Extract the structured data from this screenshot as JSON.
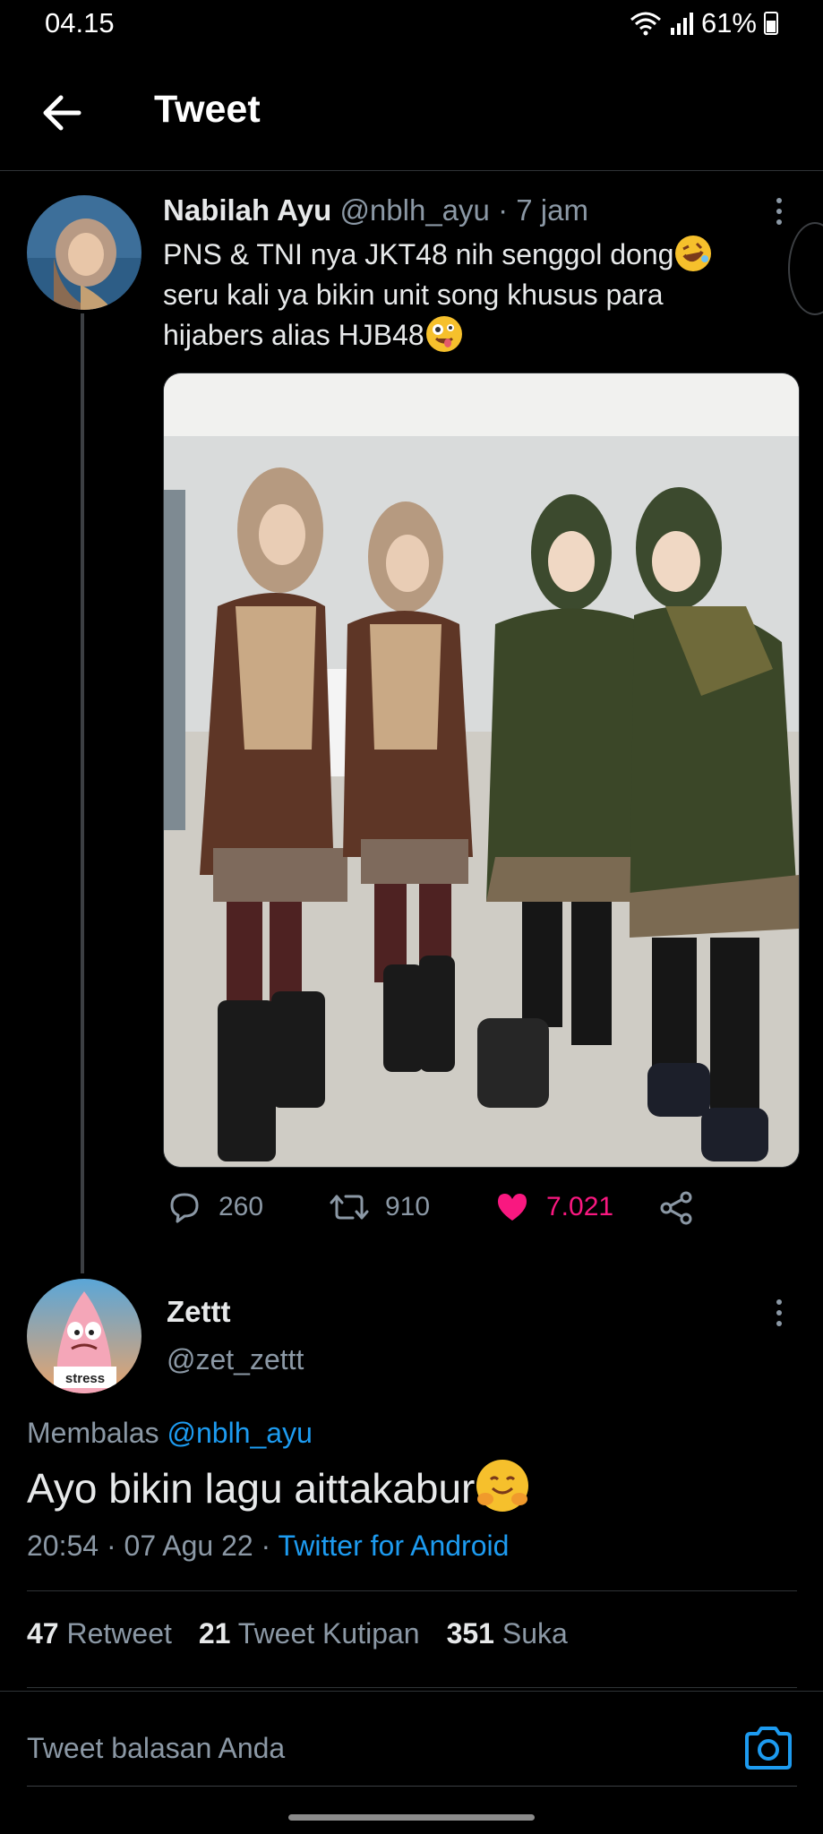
{
  "status_bar": {
    "time": "04.15",
    "battery": "61%"
  },
  "header": {
    "title": "Tweet"
  },
  "main_tweet": {
    "display_name": "Nabilah Ayu",
    "handle": "@nblh_ayu",
    "separator": "·",
    "time_ago": "7 jam",
    "text_line1": "PNS & TNI nya JKT48 nih senggol dong",
    "text_line2": "seru kali ya bikin unit song khusus para",
    "text_line3": "hijabers alias HJB48",
    "emoji1": "rolling-on-floor-laughing",
    "emoji2": "zany-face",
    "actions": {
      "replies": "260",
      "retweets": "910",
      "likes": "7.021"
    }
  },
  "reply_tweet": {
    "display_name": "Zettt",
    "handle": "@zet_zettt",
    "avatar_caption": "stress",
    "replying_label": "Membalas",
    "replying_to": "@nblh_ayu",
    "text": "Ayo bikin lagu aittakabur",
    "emoji": "hugging-face",
    "time": "20:54",
    "dot": "·",
    "date": "07 Agu 22",
    "client": "Twitter for Android"
  },
  "stats": {
    "retweet_count": "47",
    "retweet_label": "Retweet",
    "quote_count": "21",
    "quote_label": "Tweet Kutipan",
    "like_count": "351",
    "like_label": "Suka"
  },
  "reply_bar": {
    "placeholder": "Tweet balasan Anda"
  },
  "colors": {
    "accent": "#1d9bf0",
    "like": "#f91880",
    "muted": "#8b98a5",
    "divider": "#2f3336"
  }
}
